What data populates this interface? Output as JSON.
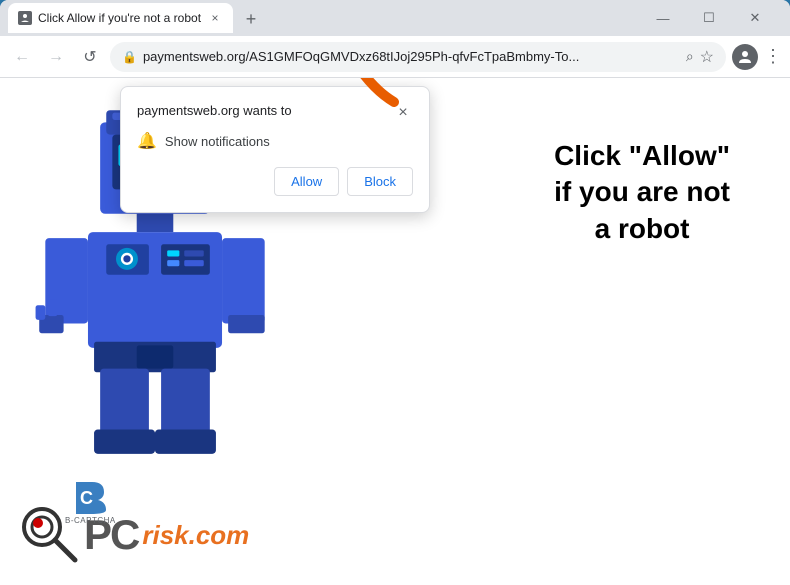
{
  "browser": {
    "tab": {
      "title": "Click Allow if you're not a robot",
      "favicon": "🔒",
      "close_label": "×"
    },
    "new_tab_label": "+",
    "window_controls": {
      "minimize": "—",
      "maximize": "☐",
      "close": "✕"
    },
    "toolbar": {
      "back_label": "←",
      "forward_label": "→",
      "reload_label": "↺",
      "address": "paymentsweb.org/AS1GMFOqGMVDxz68tIJoj295Ph-qfvFcTpaBmbmy-To...",
      "search_icon": "🔍",
      "star_icon": "☆",
      "profile_icon": "👤",
      "menu_icon": "⋮",
      "shield_icon": "🔒"
    },
    "popup": {
      "title": "paymentsweb.org wants to",
      "close_label": "×",
      "notification_label": "Show notifications",
      "allow_label": "Allow",
      "block_label": "Block"
    }
  },
  "page": {
    "click_allow_line1": "Click \"Allow\"",
    "click_allow_line2": "if you are not",
    "click_allow_line3": "a robot"
  },
  "icons": {
    "bell": "🔔",
    "lock": "🔒",
    "search": "⌕",
    "star": "☆",
    "shield": "🛡"
  }
}
